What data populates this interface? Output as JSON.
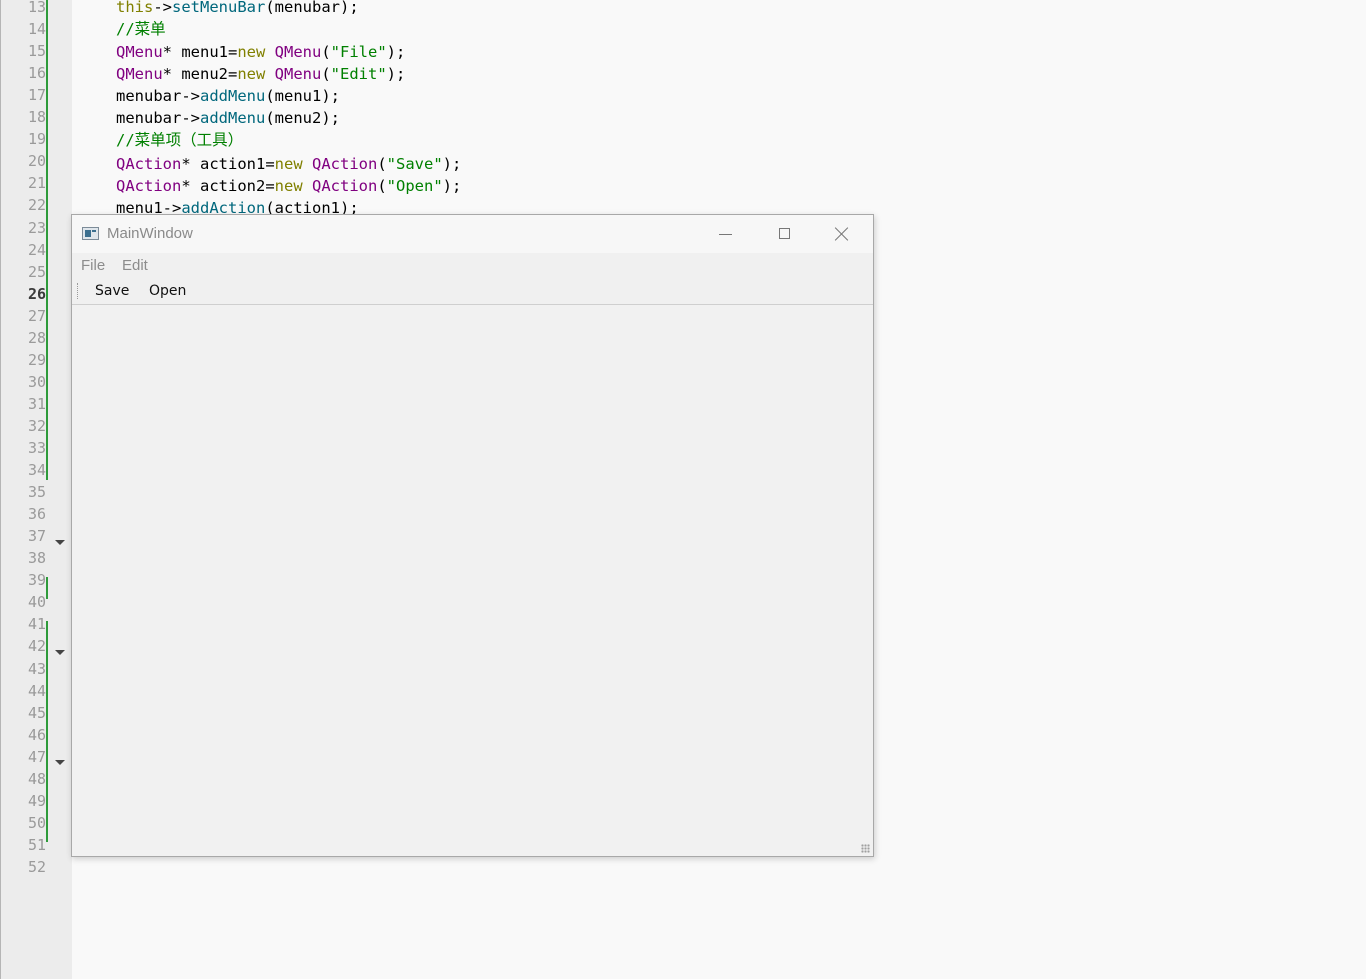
{
  "editor": {
    "line_numbers": [
      "13",
      "14",
      "15",
      "16",
      "17",
      "18",
      "19",
      "20",
      "21",
      "22",
      "23",
      "24",
      "25",
      "26",
      "27",
      "28",
      "29",
      "30",
      "31",
      "32",
      "33",
      "34",
      "35",
      "36",
      "37",
      "38",
      "39",
      "40",
      "41",
      "42",
      "43",
      "44",
      "45",
      "46",
      "47",
      "48",
      "49",
      "50",
      "51",
      "52"
    ],
    "current_line": "26",
    "code": {
      "l13": {
        "a": "this",
        "b": "->",
        "c": "setMenuBar",
        "d": "(menubar);"
      },
      "l14": "//菜单",
      "l15": {
        "type": "QMenu",
        "mid": "* menu1=",
        "kw": "new",
        "type2": " QMenu",
        "p1": "(",
        "str": "\"File\"",
        "p2": ");"
      },
      "l16": {
        "type": "QMenu",
        "mid": "* menu2=",
        "kw": "new",
        "type2": " QMenu",
        "p1": "(",
        "str": "\"Edit\"",
        "p2": ");"
      },
      "l17": {
        "a": "menubar->",
        "fn": "addMenu",
        "b": "(menu1);"
      },
      "l18": {
        "a": "menubar->",
        "fn": "addMenu",
        "b": "(menu2);"
      },
      "l19": "//菜单项（工具）",
      "l20": {
        "type": "QAction",
        "mid": "* action1=",
        "kw": "new",
        "type2": " QAction",
        "p1": "(",
        "str": "\"Save\"",
        "p2": ");"
      },
      "l21": {
        "type": "QAction",
        "mid": "* action2=",
        "kw": "new",
        "type2": " QAction",
        "p1": "(",
        "str": "\"Open\"",
        "p2": ");"
      },
      "l22": {
        "a": "menu1->",
        "fn": "addAction",
        "b": "(action1);"
      }
    },
    "colors": {
      "type": "#800080",
      "keyword": "#808000",
      "function": "#00677c",
      "string": "#008000",
      "change_bar": "#2e9b3a"
    }
  },
  "window": {
    "title": "MainWindow",
    "icon": "qt-window-icon",
    "controls": [
      "minimize-icon",
      "maximize-icon",
      "close-icon"
    ],
    "menu": [
      "File",
      "Edit"
    ],
    "toolbar": [
      "Save",
      "Open"
    ]
  }
}
